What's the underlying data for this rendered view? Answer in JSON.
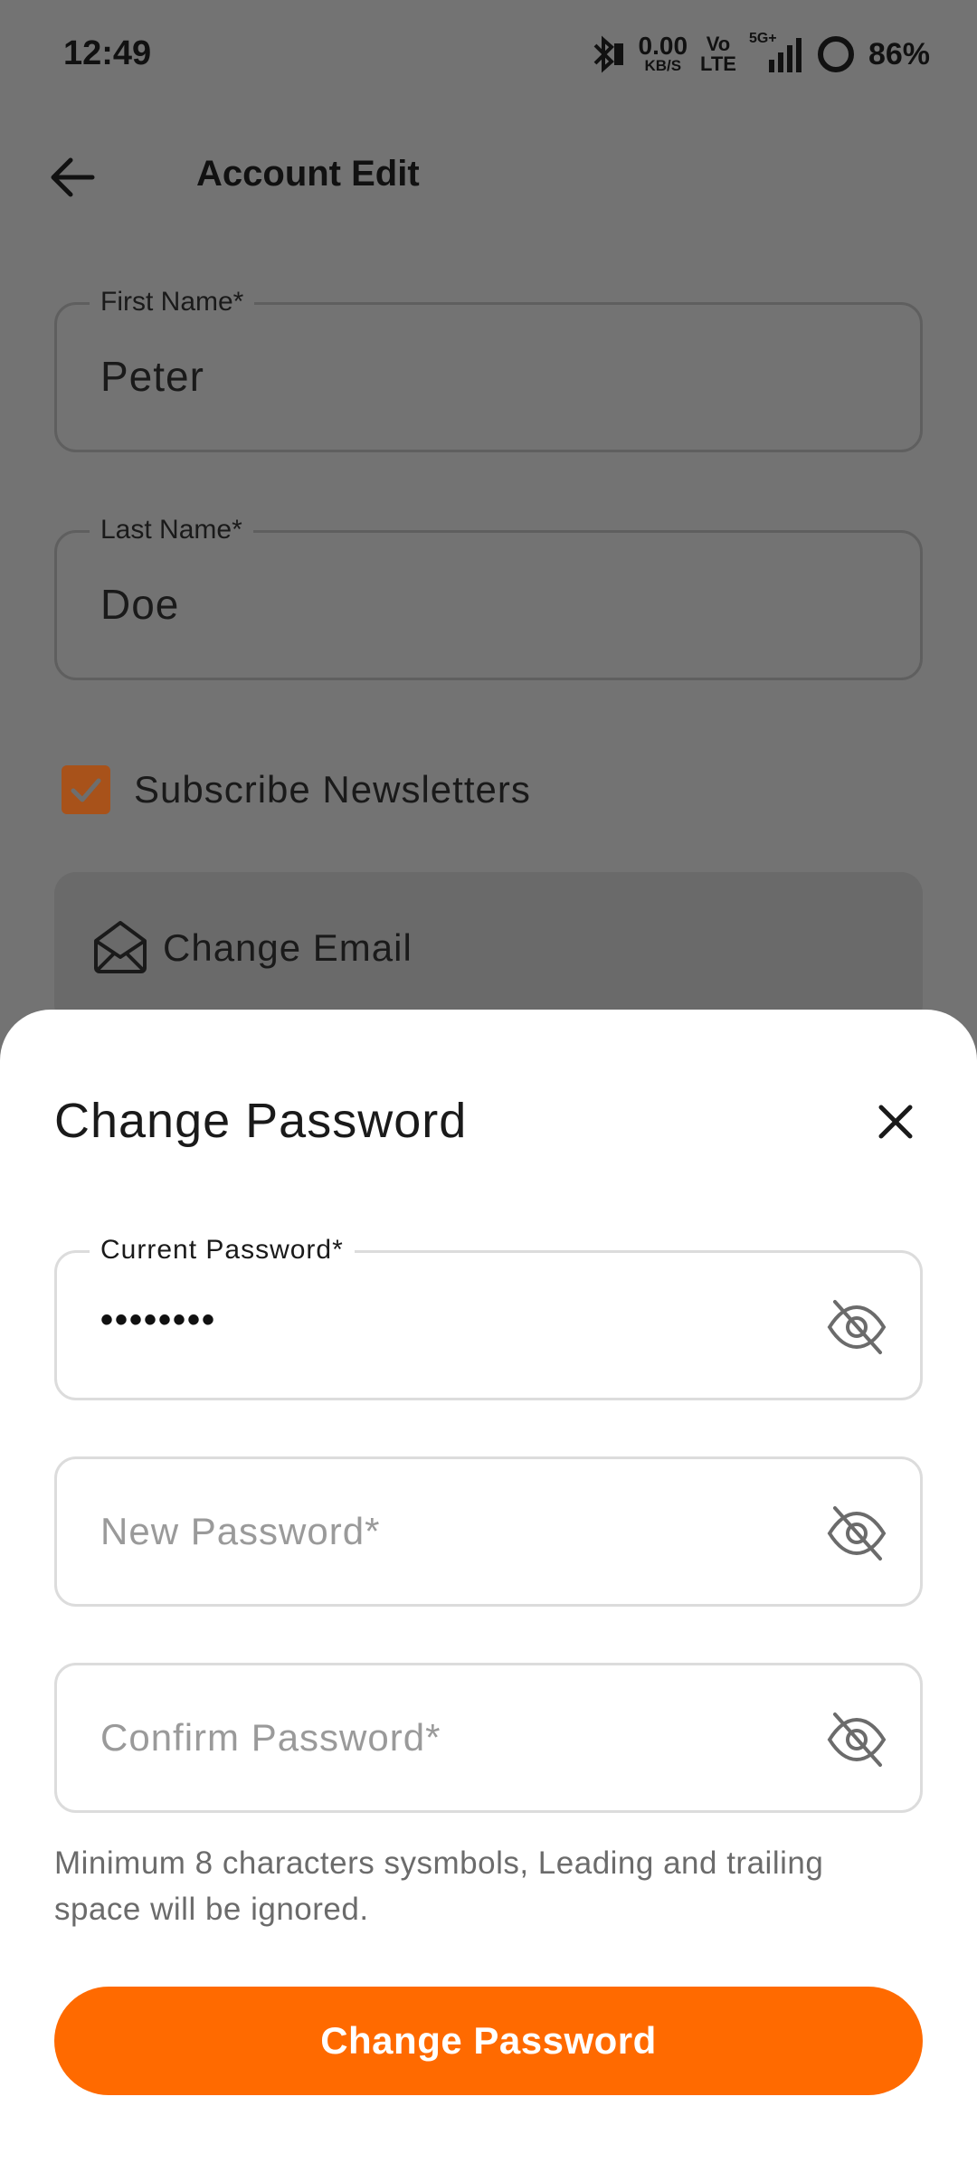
{
  "status_bar": {
    "time": "12:49",
    "net_speed_value": "0.00",
    "net_speed_unit": "KB/S",
    "volte_top": "Vo",
    "volte_bottom": "LTE",
    "network": "5G+",
    "battery": "86%"
  },
  "app_bar": {
    "title": "Account Edit",
    "back_icon": "arrow-left-icon"
  },
  "form": {
    "first_name": {
      "label": "First Name*",
      "value": "Peter"
    },
    "last_name": {
      "label": "Last Name*",
      "value": "Doe"
    },
    "subscribe": {
      "label": "Subscribe Newsletters",
      "checked": true,
      "color": "#a8521a"
    },
    "change_email": {
      "label": "Change Email",
      "icon": "mail-open-icon"
    }
  },
  "sheet": {
    "title": "Change Password",
    "close_icon": "close-icon",
    "current_password": {
      "label": "Current Password*",
      "value": "••••••••",
      "icon": "eye-off-icon"
    },
    "new_password": {
      "placeholder": "New Password*",
      "icon": "eye-off-icon"
    },
    "confirm_password": {
      "placeholder": "Confirm Password*",
      "icon": "eye-off-icon"
    },
    "hint": "Minimum 8 characters sysmbols, Leading and trailing space will be ignored.",
    "button_label": "Change Password",
    "accent_color": "#ff6a00"
  }
}
